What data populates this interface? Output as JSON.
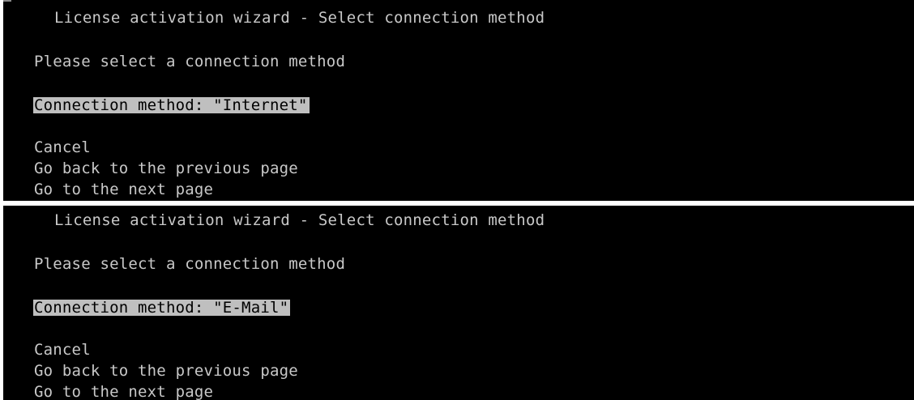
{
  "screens": [
    {
      "title": "License activation wizard - Select connection method",
      "prompt": "Please select a connection method",
      "field": "Connection method: \"Internet\"",
      "actions": {
        "cancel": "Cancel",
        "back": "Go back to the previous page",
        "next": "Go to the next page"
      }
    },
    {
      "title": "License activation wizard - Select connection method",
      "prompt": "Please select a connection method",
      "field": "Connection method: \"E-Mail\"",
      "actions": {
        "cancel": "Cancel",
        "back": "Go back to the previous page",
        "next": "Go to the next page"
      }
    }
  ]
}
